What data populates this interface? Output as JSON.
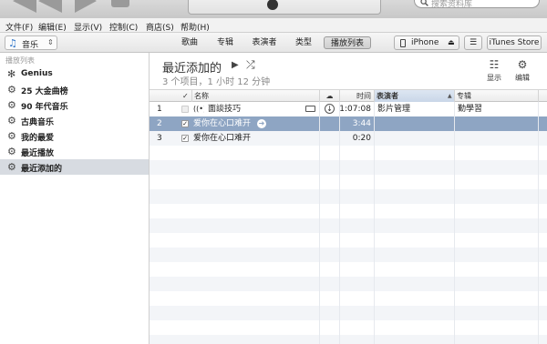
{
  "toolbar_top": {
    "search_placeholder": "搜索资料库"
  },
  "menubar": {
    "items": [
      "文件(F)",
      "编辑(E)",
      "显示(V)",
      "控制(C)",
      "商店(S)",
      "帮助(H)"
    ]
  },
  "source_toolbar": {
    "library_label": "音乐",
    "tabs": [
      "歌曲",
      "专辑",
      "表演者",
      "类型",
      "播放列表"
    ],
    "selected_tab": "播放列表",
    "device_label": "iPhone",
    "store_label": "iTunes Store"
  },
  "sidebar": {
    "heading": "播放列表",
    "items": [
      {
        "label": "Genius",
        "icon": "genius-icon"
      },
      {
        "label": "25 大金曲榜",
        "icon": "gear-icon"
      },
      {
        "label": "90 年代音乐",
        "icon": "gear-icon"
      },
      {
        "label": "古典音乐",
        "icon": "gear-icon"
      },
      {
        "label": "我的最爱",
        "icon": "gear-icon"
      },
      {
        "label": "最近播放",
        "icon": "gear-icon"
      },
      {
        "label": "最近添加的",
        "icon": "gear-icon"
      }
    ],
    "selected": "最近添加的"
  },
  "main": {
    "title": "最近添加的",
    "subtitle": "3 个项目，1 小时 12 分钟",
    "view_label": "显示",
    "edit_label": "编辑",
    "columns": {
      "name": "名称",
      "time": "时间",
      "artist": "表演者",
      "album": "专辑"
    },
    "rows": [
      {
        "num": "1",
        "checked": false,
        "name": "面談技巧",
        "time": "1:07:08",
        "artist": "影片管理",
        "album": "勤學習"
      },
      {
        "num": "2",
        "checked": true,
        "name": "爱你在心口难开",
        "time": "3:44",
        "artist": "",
        "album": ""
      },
      {
        "num": "3",
        "checked": true,
        "name": "爱你在心口难开",
        "time": "0:20",
        "artist": "",
        "album": ""
      }
    ],
    "selected_row": 2
  },
  "colors": {
    "selection": "#8ea5c3",
    "sidebar_selection": "#d7dbe1",
    "accent": "#2a72c8"
  }
}
